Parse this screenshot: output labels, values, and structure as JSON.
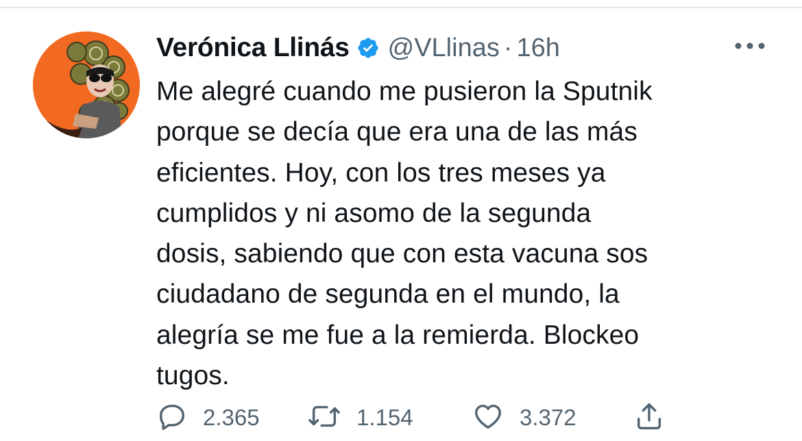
{
  "author": {
    "display_name": "Verónica Llinás",
    "handle": "@VLlinas",
    "verified": true,
    "avatar_bg": "#f26a21"
  },
  "meta": {
    "separator": "·",
    "time": "16h"
  },
  "tweet": {
    "text": "Me alegré cuando me pusieron la Sputnik\nporque se decía que era una de las más\neficientes. Hoy, con los tres meses ya\ncumplidos y ni asomo de la segunda\ndosis, sabiendo que con esta vacuna sos\nciudadano de segunda en el mundo, la\nalegría se me fue a la remierda. Blockeo\ntugos."
  },
  "actions": {
    "reply_count": "2.365",
    "retweet_count": "1.154",
    "like_count": "3.372"
  },
  "icons": {
    "more": "more-horizontal-icon",
    "reply": "reply-bubble-icon",
    "retweet": "retweet-icon",
    "like": "heart-icon",
    "share": "share-icon",
    "verified": "verified-badge-icon"
  },
  "colors": {
    "text": "#0f1419",
    "secondary": "#536471",
    "verified": "#1d9bf0"
  }
}
